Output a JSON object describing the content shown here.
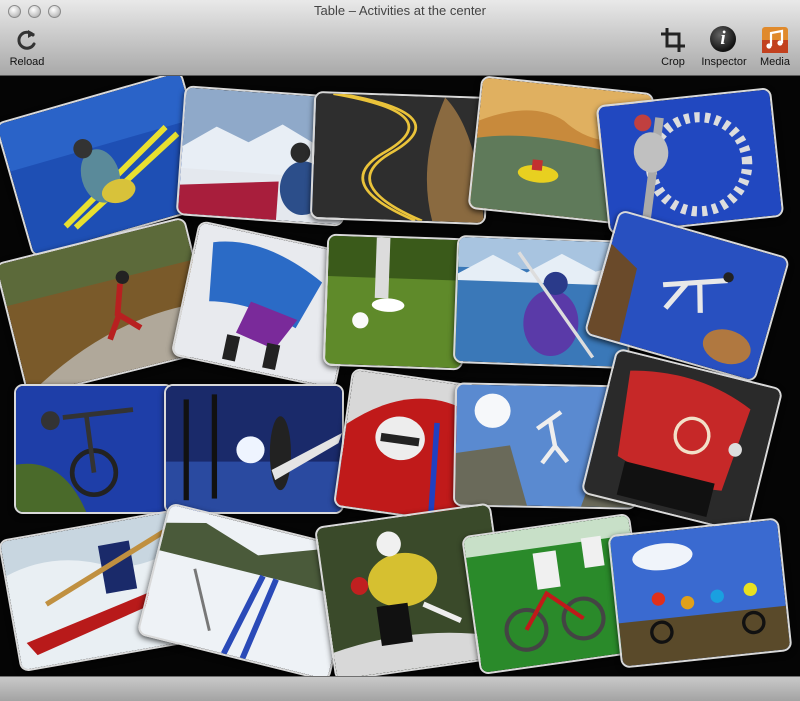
{
  "window": {
    "title": "Table – Activities at the center"
  },
  "toolbar": {
    "reload_label": "Reload",
    "crop_label": "Crop",
    "inspector_label": "Inspector",
    "media_label": "Media",
    "inspector_glyph": "i"
  },
  "icons": {
    "reload": "reload-icon",
    "crop": "crop-icon",
    "inspector": "info-icon",
    "media": "media-icon"
  },
  "colors": {
    "stage_background": "#050505",
    "toolbar_gradient_top": "#e9e9e9",
    "toolbar_gradient_bottom": "#a9a9a9"
  },
  "photos": [
    {
      "subject": "skier-jump"
    },
    {
      "subject": "snow-picnic"
    },
    {
      "subject": "winding-road"
    },
    {
      "subject": "canyon-raft"
    },
    {
      "subject": "mountain-bike-closeup"
    },
    {
      "subject": "inline-skater"
    },
    {
      "subject": "snowboard-motion"
    },
    {
      "subject": "golf-tee"
    },
    {
      "subject": "lake-kayaker"
    },
    {
      "subject": "rock-leap"
    },
    {
      "subject": "bike-jump"
    },
    {
      "subject": "surfer-palms"
    },
    {
      "subject": "bobsled"
    },
    {
      "subject": "cliff-jumper"
    },
    {
      "subject": "runner"
    },
    {
      "subject": "whitewater-kayak"
    },
    {
      "subject": "cross-country-ski"
    },
    {
      "subject": "road-cyclist"
    },
    {
      "subject": "race-cyclists"
    },
    {
      "subject": "group-mountain-bikers"
    }
  ]
}
